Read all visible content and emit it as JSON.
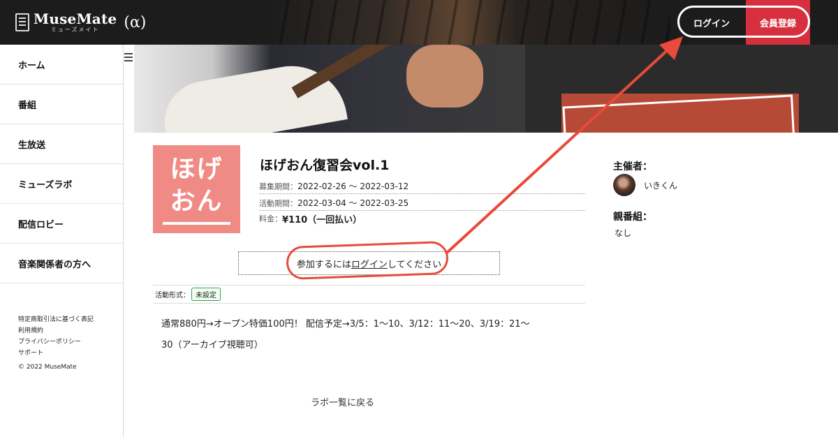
{
  "header": {
    "logo_name": "MuseMate",
    "logo_kana": "ミューズメイト",
    "logo_alpha": "(α)",
    "login_label": "ログイン",
    "signup_label": "会員登録",
    "signup_color": "#d6303f"
  },
  "sidebar": {
    "items": [
      {
        "label": "ホーム"
      },
      {
        "label": "番組"
      },
      {
        "label": "生放送"
      },
      {
        "label": "ミューズラボ"
      },
      {
        "label": "配信ロビー"
      },
      {
        "label": "音楽関係者の方へ"
      }
    ],
    "footer_links": [
      "特定商取引法に基づく表記",
      "利用規約",
      "プライバシーポリシー",
      "サポート"
    ],
    "copyright": "© 2022 MuseMate"
  },
  "event": {
    "thumb_text_line1": "ほげ",
    "thumb_text_line2": "おん",
    "title": "ほげおん復習会vol.1",
    "recruit_label": "募集期間：",
    "recruit_period": "2022-02-26 〜 2022-03-12",
    "activity_label": "活動期間：",
    "activity_period": "2022-03-04 〜 2022-03-25",
    "fee_label": "料金：",
    "fee_value": "¥110（一回払い）",
    "join_prefix": "参加するには",
    "join_link": "ログイン",
    "join_suffix": "してください",
    "format_label": "活動形式：",
    "format_value": "未設定",
    "description_line1": "通常880円→オープン特価100円！ 配信予定→3/5：1〜10、3/12：11〜20、3/19：21〜",
    "description_line2": "30（アーカイブ視聴可）",
    "back_link": "ラボ一覧に戻る"
  },
  "side_info": {
    "host_label": "主催者：",
    "host_name": "いきくん",
    "parent_label": "親番組：",
    "parent_value": "なし"
  },
  "annotation_color": "#e84a3b"
}
